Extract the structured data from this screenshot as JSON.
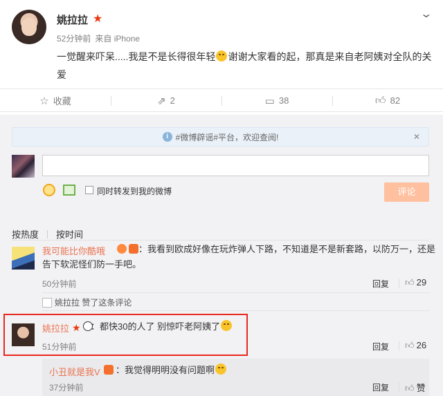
{
  "post": {
    "author": "姚拉拉",
    "time": "52分钟前",
    "source": "来自 iPhone",
    "text_before": "一觉醒来吓呆.....我是不是长得很年轻",
    "text_after": "谢谢大家看的起，那真是来自老阿姨对全队的关爱"
  },
  "actions": {
    "favorite_label": "收藏",
    "repost_count": "2",
    "comment_count": "38",
    "like_count": "82"
  },
  "notice": {
    "text": "#微博辟谣#平台，欢迎查阅!"
  },
  "composer": {
    "placeholder": "",
    "repost_label": "同时转发到我的微博",
    "submit_label": "评论"
  },
  "sort": {
    "hot": "按热度",
    "time": "按时间"
  },
  "comments": [
    {
      "name": "我可能比你酷哦",
      "text_line1": "：我看到欧成好像在玩炸弹人下路，不知道是不是新套路，以防万一，还是",
      "text_line2": "告下软泥怪们防一手吧。",
      "time": "50分钟前",
      "reply": "回复",
      "likes": "29",
      "liked_by_name": "姚拉拉",
      "liked_by_text": "赞了这条评论"
    },
    {
      "name": "姚拉拉",
      "text": "：都快30的人了  别惊吓老阿姨了",
      "time": "51分钟前",
      "reply": "回复",
      "likes": "26"
    }
  ],
  "sub_reply": {
    "name": "小丑就是我V",
    "text": "：我觉得明明没有问题啊",
    "time": "37分钟前",
    "reply": "回复",
    "like_label": "赞"
  },
  "colors": {
    "accent": "#eb7350",
    "highlight": "#e8271d",
    "submit_bg": "#ffc09f"
  }
}
